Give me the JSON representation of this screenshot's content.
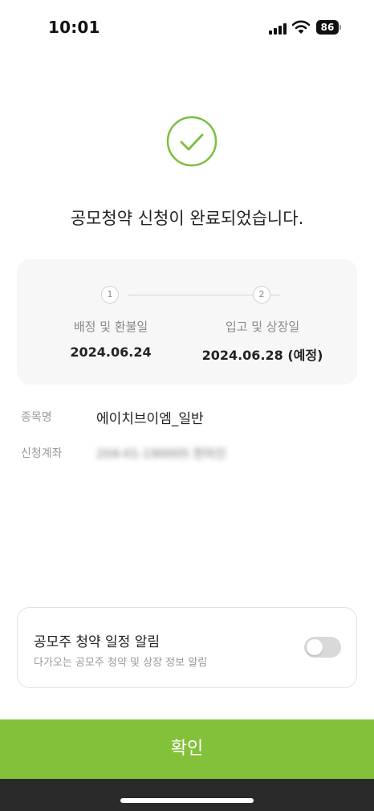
{
  "status_bar": {
    "time": "10:01",
    "battery": "86",
    "icons": [
      "signal-icon",
      "wifi-icon",
      "battery-icon"
    ]
  },
  "result": {
    "icon": "check-circle-icon",
    "message": "공모청약 신청이 완료되었습니다."
  },
  "schedule": {
    "steps": [
      {
        "number": "1",
        "label": "배정 및 환불일",
        "date": "2024.06.24"
      },
      {
        "number": "2",
        "label": "입고 및 상장일",
        "date": "2024.06.28 (예정)"
      }
    ]
  },
  "details": {
    "stock_label": "종목명",
    "stock_value": "에이치브이엠_일반",
    "account_label": "신청계좌",
    "account_value": "204-01-190005 한마진"
  },
  "notification": {
    "title": "공모주 청약 일정 알림",
    "subtitle": "다가오는 공모주 청약 및 상장 정보 알림",
    "enabled": false
  },
  "confirm_label": "확인",
  "colors": {
    "accent": "#84c13b",
    "check": "#7cbf3a",
    "card_bg": "#f7f7f7"
  }
}
